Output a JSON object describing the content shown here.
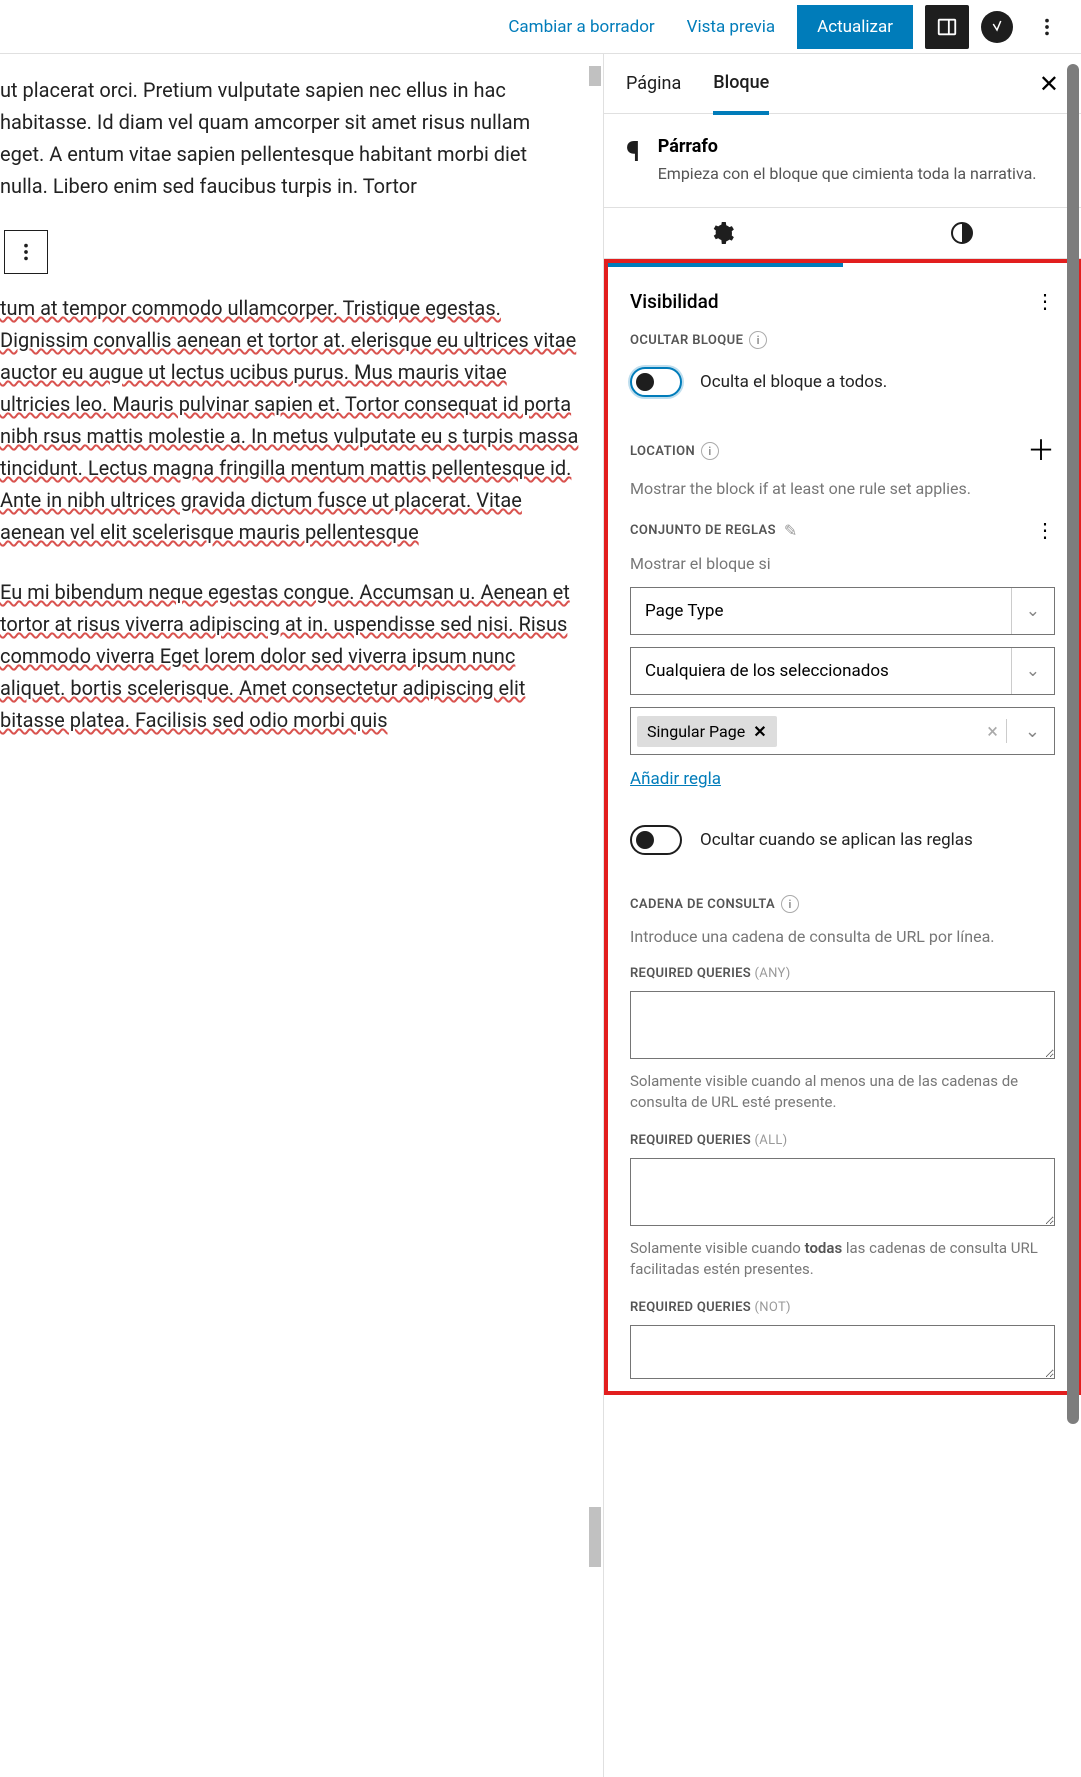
{
  "topbar": {
    "draft": "Cambiar a borrador",
    "preview": "Vista previa",
    "update": "Actualizar"
  },
  "editor": {
    "para1": "ut placerat orci. Pretium vulputate sapien nec ellus in hac habitasse. Id diam vel quam amcorper sit amet risus nullam eget. A entum vitae sapien pellentesque habitant morbi diet nulla. Libero enim sed faucibus turpis in. Tortor",
    "para2": "tum at tempor commodo ullamcorper. Tristique egestas. Dignissim convallis aenean et tortor at. elerisque eu ultrices vitae auctor eu augue ut lectus ucibus purus. Mus mauris vitae ultricies leo. Mauris pulvinar sapien et. Tortor consequat id porta nibh rsus mattis molestie a. In metus vulputate eu s turpis massa tincidunt. Lectus magna fringilla mentum mattis pellentesque id. Ante in nibh ultrices gravida dictum fusce ut placerat. Vitae aenean vel elit scelerisque mauris pellentesque",
    "para3": "Eu mi bibendum neque egestas congue. Accumsan u. Aenean et tortor at risus viverra adipiscing at in. uspendisse sed nisi. Risus commodo viverra Eget lorem dolor sed viverra ipsum nunc aliquet. bortis scelerisque. Amet consectetur adipiscing elit bitasse platea. Facilisis sed odio morbi quis"
  },
  "sidebar": {
    "tab_page": "Página",
    "tab_block": "Bloque",
    "block": {
      "name": "Párrafo",
      "desc": "Empieza con el bloque que cimienta toda la narrativa."
    },
    "visibility": {
      "title": "Visibilidad",
      "hide_label": "OCULTAR BLOQUE",
      "hide_toggle_text": "Oculta el bloque a todos."
    },
    "location": {
      "title": "LOCATION",
      "help": "Mostrar the block if at least one rule set applies.",
      "ruleset_label": "CONJUNTO DE REGLAS",
      "show_if": "Mostrar el bloque si",
      "select1": "Page Type",
      "select2": "Cualquiera de los seleccionados",
      "chip": "Singular Page",
      "add_rule": "Añadir regla",
      "hide_when": "Ocultar cuando se aplican las reglas"
    },
    "query": {
      "title": "CADENA DE CONSULTA",
      "intro": "Introduce una cadena de consulta de URL por línea.",
      "req_any_label": "REQUIRED QUERIES",
      "req_any_paren": "(ANY)",
      "req_any_help": "Solamente visible cuando al menos una de las cadenas de consulta de URL esté presente.",
      "req_all_label": "REQUIRED QUERIES",
      "req_all_paren": "(ALL)",
      "req_all_help_pre": "Solamente visible cuando ",
      "req_all_help_bold": "todas",
      "req_all_help_post": " las cadenas de consulta URL facilitadas estén presentes.",
      "req_not_label": "REQUIRED QUERIES",
      "req_not_paren": "(NOT)"
    }
  }
}
